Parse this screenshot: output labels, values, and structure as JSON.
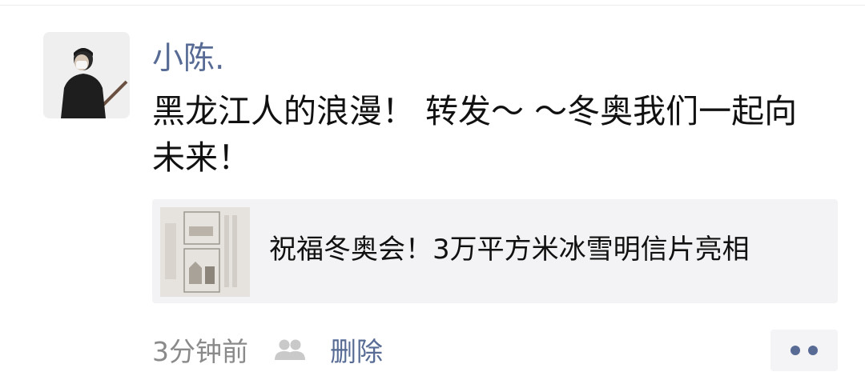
{
  "post": {
    "username": "小陈.",
    "text": "黑龙江人的浪漫！ 转发～ ～冬奥我们一起向未来！",
    "share": {
      "title": "祝福冬奥会！3万平方米冰雪明信片亮相"
    },
    "timestamp": "3分钟前",
    "delete_label": "删除"
  },
  "colors": {
    "link": "#576b95",
    "meta": "#8a8a8a",
    "card_bg": "#f3f3f5"
  },
  "icons": {
    "visibility": "people-icon",
    "more": "more-dots-icon"
  }
}
